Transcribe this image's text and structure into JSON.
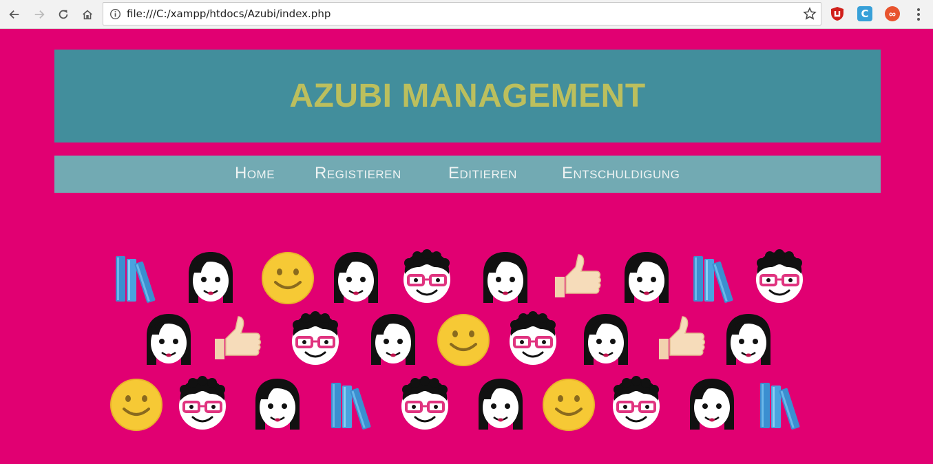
{
  "browser": {
    "url": "file:///C:/xampp/htdocs/Azubi/index.php",
    "icons": [
      "back-icon",
      "forward-icon",
      "reload-icon",
      "home-icon",
      "info-icon",
      "star-icon",
      "ublock-icon",
      "extension-c-icon",
      "extension-infinity-icon",
      "menu-dots-icon"
    ],
    "extension_c_label": "C",
    "extension_infinity_label": "∞"
  },
  "header": {
    "title": "AZUBI MANAGEMENT",
    "background": "#428e9c",
    "title_color": "#bcbf5d"
  },
  "nav": {
    "background": "#72aab3",
    "items": [
      {
        "label": "Home"
      },
      {
        "label": "Registieren"
      },
      {
        "label": "Editieren"
      },
      {
        "label": "Entschuldigung"
      }
    ]
  },
  "page": {
    "background": "#e10072"
  },
  "emoji_rows": [
    [
      "books-icon",
      "girl-face-icon",
      "smiley-icon",
      "girl-face-icon",
      "boy-glasses-face-icon",
      "girl-face-icon",
      "thumbs-up-icon",
      "girl-face-icon",
      "books-icon",
      "boy-glasses-face-icon"
    ],
    [
      "girl-face-icon",
      "thumbs-up-icon",
      "boy-glasses-face-icon",
      "girl-face-icon",
      "smiley-icon",
      "boy-glasses-face-icon",
      "girl-face-icon",
      "thumbs-up-icon",
      "girl-face-icon"
    ],
    [
      "smiley-icon",
      "boy-glasses-face-icon",
      "girl-face-icon",
      "books-icon",
      "boy-glasses-face-icon",
      "girl-face-icon",
      "smiley-icon",
      "boy-glasses-face-icon",
      "girl-face-icon",
      "books-icon"
    ]
  ]
}
